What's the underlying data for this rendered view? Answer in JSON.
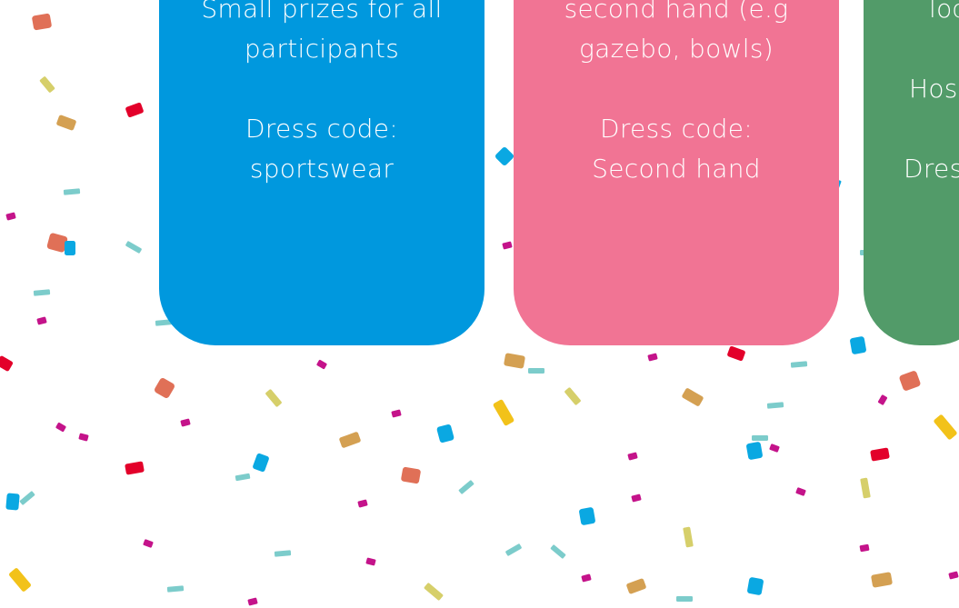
{
  "cards": [
    {
      "id": "sports",
      "color": "#0098de",
      "lines": [
        "Small prizes for all",
        "participants"
      ],
      "dress_label": "Dress code:",
      "dress_value": "sportswear"
    },
    {
      "id": "second-hand",
      "color": "#f17494",
      "lines": [
        "second hand (e.g",
        "gazebo, bowls)"
      ],
      "dress_label": "Dress code:",
      "dress_value": "Second hand"
    },
    {
      "id": "third",
      "color": "#529b69",
      "lines": [
        "loc",
        "",
        "Host"
      ],
      "dress_label": "Dres",
      "dress_value": ""
    }
  ],
  "confetti_colors": [
    "#e07057",
    "#d6cf6a",
    "#d4a052",
    "#e3002a",
    "#7ccccb",
    "#c4138a",
    "#0aa8e2",
    "#f2c21a"
  ]
}
